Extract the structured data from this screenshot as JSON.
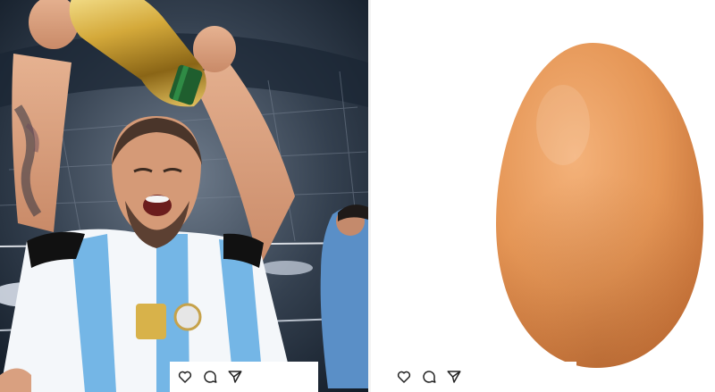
{
  "posts": [
    {
      "photo_description": "player-holding-trophy",
      "actions": {
        "like_icon": "heart-icon",
        "comment_icon": "comment-icon",
        "share_icon": "send-icon"
      }
    },
    {
      "photo_description": "egg",
      "actions": {
        "like_icon": "heart-icon",
        "comment_icon": "comment-icon",
        "share_icon": "send-icon"
      }
    }
  ],
  "colors": {
    "icon_stroke": "#222222",
    "background": "#ffffff",
    "egg": "#e0935a"
  }
}
